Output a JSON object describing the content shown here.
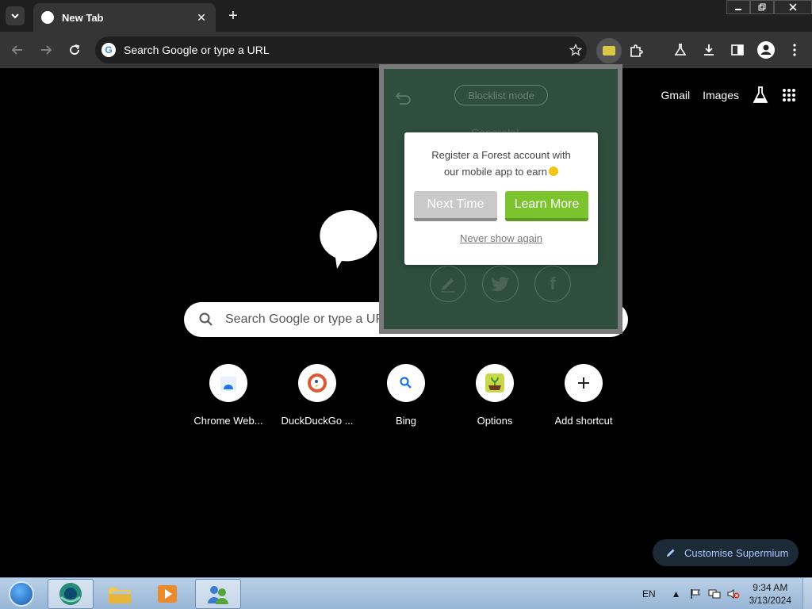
{
  "browser": {
    "tab": {
      "title": "New Tab"
    },
    "omnibox": {
      "placeholder": "Search Google or type a URL"
    }
  },
  "page": {
    "links": {
      "gmail": "Gmail",
      "images": "Images"
    },
    "search_placeholder": "Search Google or type a URL",
    "shortcuts": [
      {
        "label": "Chrome Web..."
      },
      {
        "label": "DuckDuckGo ..."
      },
      {
        "label": "Bing"
      },
      {
        "label": "Options"
      },
      {
        "label": "Add shortcut"
      }
    ],
    "customise_label": "Customise Supermium"
  },
  "forest_popup": {
    "blocklist_label": "Blocklist mode",
    "congrats_text": "Congrats!",
    "modal": {
      "line1": "Register a Forest account with",
      "line2": "our mobile app to earn",
      "next_time": "Next Time",
      "learn_more": "Learn More",
      "never_show": "Never show again"
    }
  },
  "taskbar": {
    "language": "EN",
    "time": "9:34 AM",
    "date": "3/13/2024"
  }
}
